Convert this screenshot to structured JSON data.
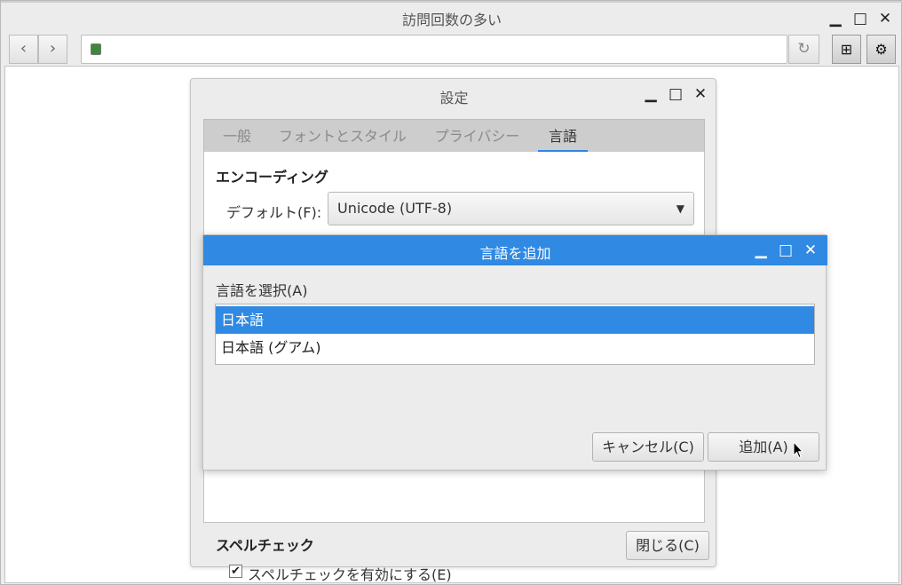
{
  "browser": {
    "title": "訪問回数の多い",
    "controls": {
      "minimize": "▁",
      "maximize": "□",
      "close": "✕"
    },
    "nav": {
      "back": "‹",
      "forward": "›",
      "reload": "↻"
    },
    "address": {
      "value": "",
      "favicon": "page-favicon"
    },
    "toolbar": {
      "bookmark_icon": "bookmark-add-icon",
      "bookmark": "⊞",
      "settings_icon": "gear-icon",
      "settings": "⚙"
    }
  },
  "settings": {
    "title": "設定",
    "controls": {
      "minimize": "▁",
      "maximize": "□",
      "close": "✕"
    },
    "tabs": [
      {
        "label": "一般",
        "active": false
      },
      {
        "label": "フォントとスタイル",
        "active": false
      },
      {
        "label": "プライバシー",
        "active": false
      },
      {
        "label": "言語",
        "active": true
      }
    ],
    "encoding": {
      "heading": "エンコーディング",
      "default_label": "デフォルト(F):",
      "default_value": "Unicode (UTF-8)",
      "arrow": "▼"
    },
    "spellcheck": {
      "heading": "スペルチェック",
      "enable_label": "スペルチェックを有効にする(E)",
      "checked": true,
      "check_mark": "✔"
    },
    "close_button": "閉じる(C)"
  },
  "add_language": {
    "title": "言語を追加",
    "controls": {
      "minimize": "▁",
      "maximize": "□",
      "close": "✕"
    },
    "select_label": "言語を選択(A)",
    "languages": [
      {
        "label": "日本語",
        "selected": true
      },
      {
        "label": "日本語 (グアム)",
        "selected": false
      }
    ],
    "cancel_button": "キャンセル(C)",
    "add_button": "追加(A)"
  },
  "colors": {
    "accent": "#3089e2",
    "window_bg": "#ececec",
    "content_bg": "#ffffff"
  }
}
